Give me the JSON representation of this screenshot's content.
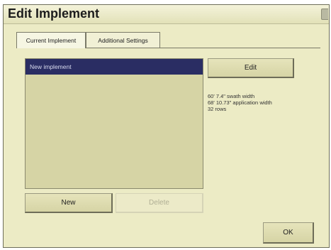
{
  "window": {
    "title": "Edit Implement"
  },
  "tabs": [
    {
      "label": "Current Implement"
    },
    {
      "label": "Additional Settings"
    }
  ],
  "implement_list": {
    "items": [
      {
        "label": "New implement",
        "selected": true
      }
    ]
  },
  "buttons": {
    "edit": "Edit",
    "new": "New",
    "delete": "Delete",
    "ok": "OK"
  },
  "details": {
    "lines": [
      "60' 7.4\" swath width",
      "68' 10.73\" application width",
      "32 rows"
    ]
  },
  "colors": {
    "window_bg": "#ecebc5",
    "selection": "#2a2d63",
    "list_bg": "#d6d4a5"
  }
}
